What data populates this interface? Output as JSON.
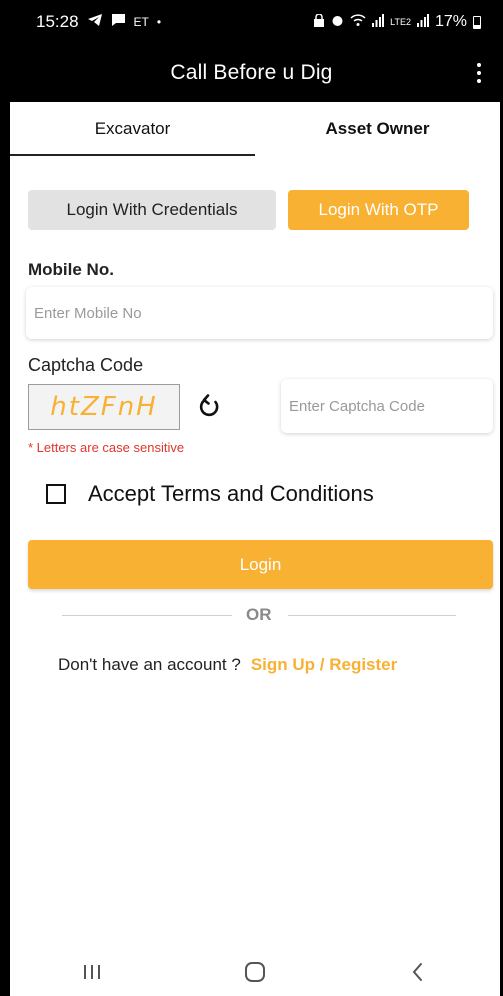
{
  "status_bar": {
    "time": "15:28",
    "carrier": "ET",
    "network": "LTE2",
    "battery": "17%"
  },
  "app_bar": {
    "title": "Call Before u Dig"
  },
  "tabs": [
    {
      "label": "Excavator",
      "active": true
    },
    {
      "label": "Asset Owner",
      "active": false
    }
  ],
  "login_mode": {
    "credentials_label": "Login With Credentials",
    "otp_label": "Login With OTP",
    "selected": "otp"
  },
  "form": {
    "mobile_label": "Mobile No.",
    "mobile_placeholder": "Enter Mobile No",
    "captcha_label": "Captcha Code",
    "captcha_text": "htZFnH",
    "captcha_placeholder": "Enter Captcha Code",
    "case_hint": "* Letters are case sensitive",
    "terms_label": "Accept Terms and Conditions",
    "terms_checked": false
  },
  "actions": {
    "login_label": "Login",
    "or_text": "OR",
    "signup_prefix": "Don't have an account ?",
    "signup_link": "Sign Up / Register"
  },
  "colors": {
    "accent": "#f8b133",
    "error": "#e0352b",
    "header_bg": "#000000"
  }
}
